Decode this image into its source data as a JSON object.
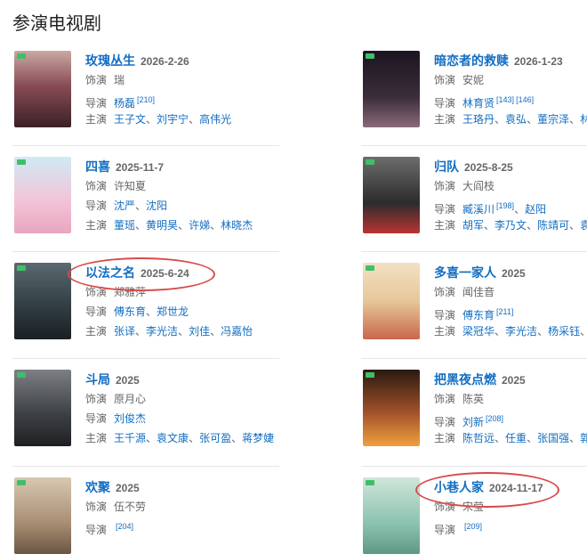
{
  "section_title": "参演电视剧",
  "labels": {
    "role": "饰演",
    "director": "导演",
    "cast": "主演"
  },
  "dramas": [
    {
      "title": "玫瑰丛生",
      "date": "2026-2-26",
      "role": "瑞",
      "directors": [
        {
          "name": "杨磊",
          "ref": "[210]"
        }
      ],
      "cast": [
        "王子文",
        "刘宇宁",
        "高伟光"
      ]
    },
    {
      "title": "暗恋者的救赎",
      "date": "2026-1-23",
      "role": "安妮",
      "directors": [
        {
          "name": "林育贤",
          "ref": "[143]",
          "ref2": "[146]"
        }
      ],
      "cast": [
        "王珞丹",
        "袁弘",
        "董宗泽",
        "林"
      ]
    },
    {
      "title": "四喜",
      "date": "2025-11-7",
      "role": "许知夏",
      "directors": [
        {
          "name": "沈严"
        },
        {
          "name": "沈阳"
        }
      ],
      "cast": [
        "董瑶",
        "黄明昊",
        "许娣",
        "林晓杰"
      ]
    },
    {
      "title": "归队",
      "date": "2025-8-25",
      "role": "大阎枝",
      "directors": [
        {
          "name": "臧溪川",
          "ref": "[198]"
        },
        {
          "name": "赵阳"
        }
      ],
      "cast": [
        "胡军",
        "李乃文",
        "陈靖可",
        "袁"
      ]
    },
    {
      "title": "以法之名",
      "date": "2025-6-24",
      "role": "郑雅萍",
      "directors": [
        {
          "name": "傅东育"
        },
        {
          "name": "郑世龙"
        }
      ],
      "cast": [
        "张译",
        "李光洁",
        "刘佳",
        "冯嘉怡"
      ]
    },
    {
      "title": "多喜一家人",
      "date": "2025",
      "role": "闻佳音",
      "directors": [
        {
          "name": "傅东育",
          "ref": "[211]"
        }
      ],
      "cast": [
        "梁冠华",
        "李光洁",
        "杨采钰",
        ""
      ]
    },
    {
      "title": "斗局",
      "date": "2025",
      "role": "原月心",
      "directors": [
        {
          "name": "刘俊杰"
        }
      ],
      "cast": [
        "王千源",
        "袁文康",
        "张可盈",
        "蒋梦婕"
      ]
    },
    {
      "title": "把黑夜点燃",
      "date": "2025",
      "role": "陈英",
      "directors": [
        {
          "name": "刘新",
          "ref": "[208]"
        }
      ],
      "cast": [
        "陈哲远",
        "任重",
        "张国强",
        "郭"
      ]
    },
    {
      "title": "欢聚",
      "date": "2025",
      "role": "伍不劳",
      "directors": [
        {
          "name": "",
          "ref": "[204]"
        }
      ],
      "cast": []
    },
    {
      "title": "小巷人家",
      "date": "2024-11-17",
      "role": "宋莹",
      "directors": [
        {
          "name": "",
          "ref": "[209]"
        }
      ],
      "cast": []
    }
  ]
}
